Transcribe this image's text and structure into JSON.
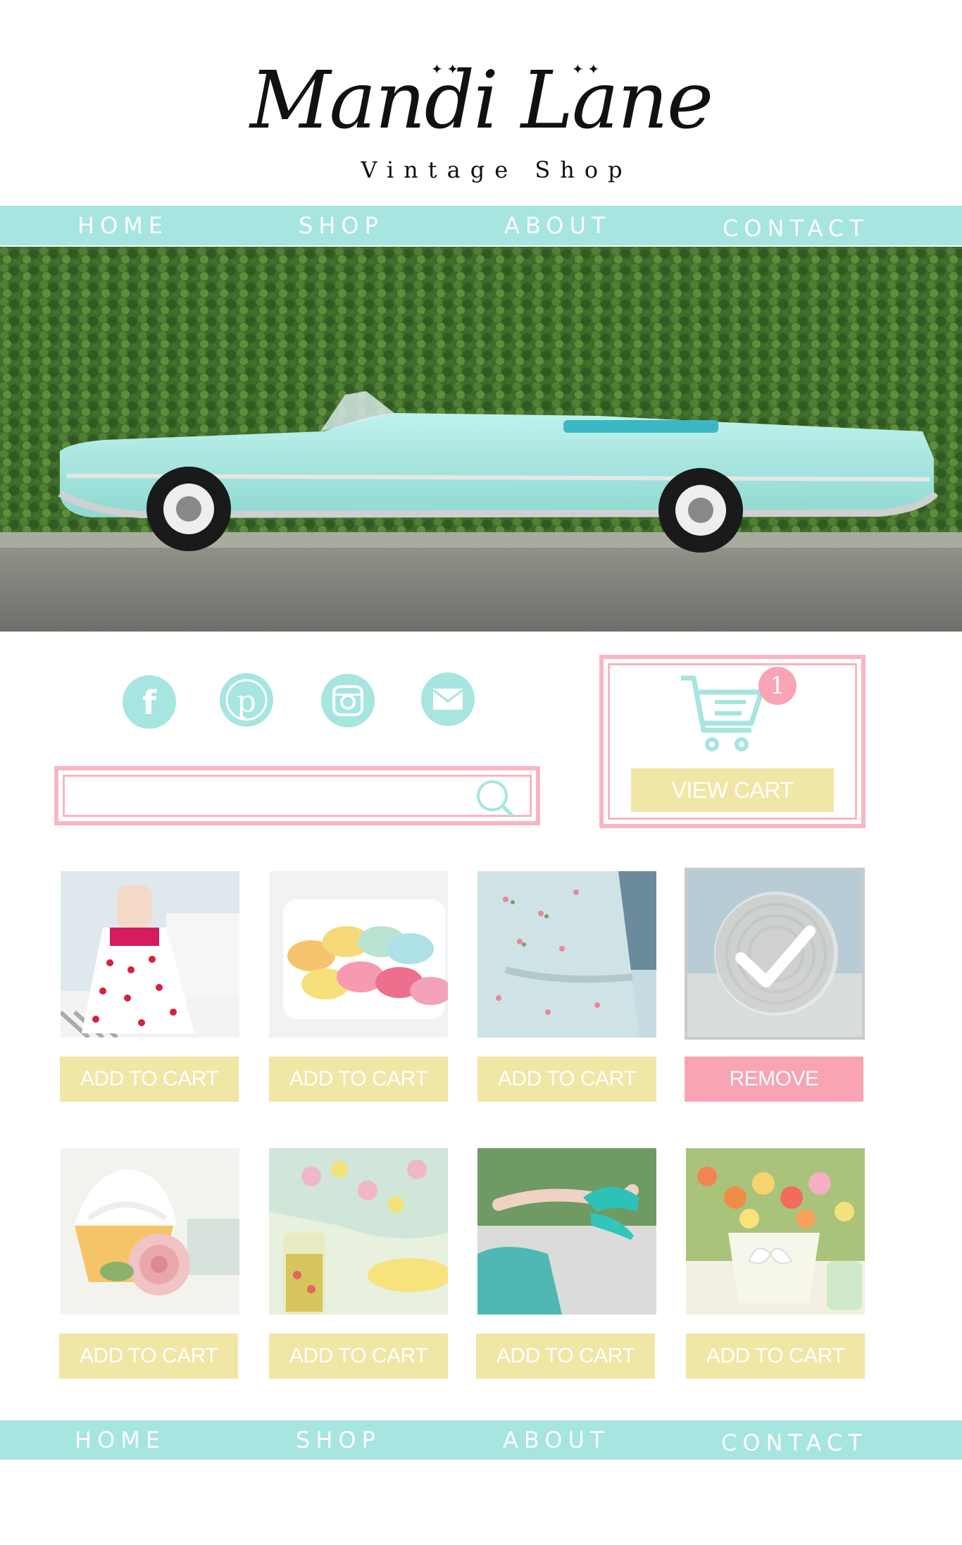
{
  "brand": {
    "name": "Mandi Lane",
    "tagline": "Vintage Shop"
  },
  "nav_top": [
    "HOME",
    "SHOP",
    "ABOUT",
    "CONTACT"
  ],
  "nav_bottom": [
    "HOME",
    "SHOP",
    "ABOUT",
    "CONTACT"
  ],
  "social": [
    "facebook-icon",
    "pinterest-icon",
    "instagram-icon",
    "email-icon"
  ],
  "search": {
    "value": "",
    "placeholder": ""
  },
  "cart": {
    "count": "1",
    "button_label": "VIEW CART"
  },
  "products": [
    {
      "image": "polka-dot-dress-photo",
      "button": "ADD TO CART",
      "state": "available"
    },
    {
      "image": "macarons-photo",
      "button": "ADD TO CART",
      "state": "available"
    },
    {
      "image": "floral-blue-dress-photo",
      "button": "ADD TO CART",
      "state": "available"
    },
    {
      "image": "hat-photo",
      "button": "REMOVE",
      "state": "in-cart"
    },
    {
      "image": "cupcake-rose-photo",
      "button": "ADD TO CART",
      "state": "available"
    },
    {
      "image": "lemonade-picnic-photo",
      "button": "ADD TO CART",
      "state": "available"
    },
    {
      "image": "turquoise-heels-photo",
      "button": "ADD TO CART",
      "state": "available"
    },
    {
      "image": "flower-bucket-photo",
      "button": "ADD TO CART",
      "state": "available"
    }
  ],
  "colors": {
    "aqua": "#a6e5e0",
    "pink": "#f7b6c2",
    "butter": "#f0e6a6",
    "remove_pink": "#f8a4b4"
  }
}
